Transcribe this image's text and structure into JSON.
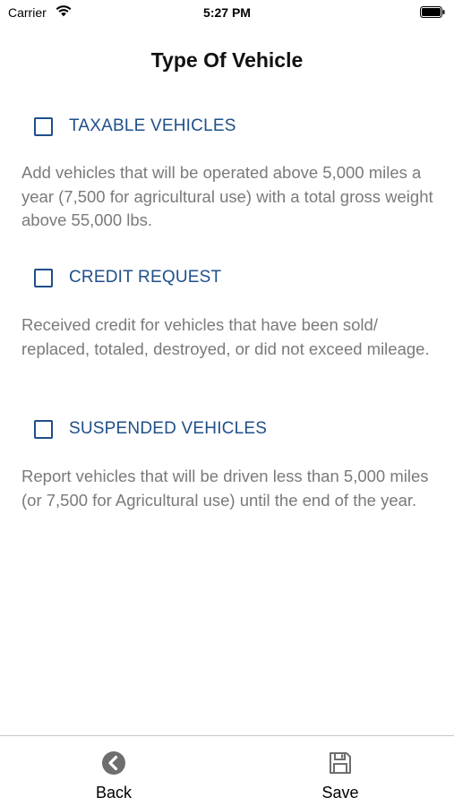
{
  "status_bar": {
    "carrier": "Carrier",
    "time": "5:27 PM"
  },
  "page": {
    "title": "Type Of Vehicle"
  },
  "options": [
    {
      "label": "TAXABLE VEHICLES",
      "checked": false,
      "description": "Add vehicles that will be operated above 5,000 miles a year (7,500 for agricultural use) with a total gross weight above 55,000 lbs."
    },
    {
      "label": "CREDIT REQUEST",
      "checked": false,
      "description": "Received credit for vehicles that have been sold/ replaced, totaled, destroyed, or did not exceed mileage."
    },
    {
      "label": "SUSPENDED VEHICLES",
      "checked": false,
      "description": "Report vehicles that will be driven less than 5,000 miles (or 7,500 for Agricultural use) until the end of the year."
    }
  ],
  "toolbar": {
    "back_label": "Back",
    "save_label": "Save"
  },
  "colors": {
    "accent": "#1f4f8a",
    "description_text": "#7a7a7a",
    "icon_gray": "#6e6e6e"
  },
  "icons": {
    "back": "chevron-left-circle-icon",
    "save": "floppy-disk-icon",
    "wifi": "wifi-icon",
    "battery": "battery-icon"
  }
}
